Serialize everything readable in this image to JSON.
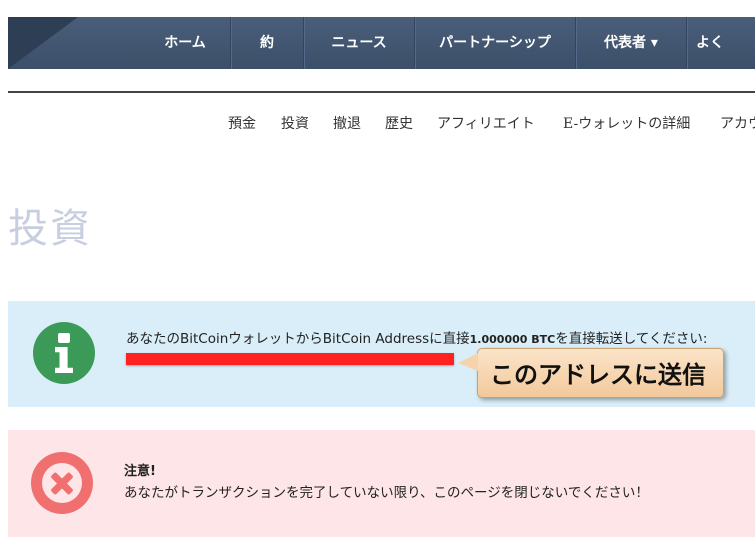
{
  "topnav": {
    "items": [
      {
        "label": "ホーム"
      },
      {
        "label": "約"
      },
      {
        "label": "ニュース"
      },
      {
        "label": "パートナーシップ"
      },
      {
        "label": "代表者 ▾"
      },
      {
        "label": "よく"
      }
    ]
  },
  "subnav": {
    "items": [
      {
        "label": "預金"
      },
      {
        "label": "投資"
      },
      {
        "label": "撤退"
      },
      {
        "label": "歴史"
      },
      {
        "label": "アフィリエイト"
      },
      {
        "label": "E-ウォレットの詳細"
      },
      {
        "label": "アカウ"
      }
    ]
  },
  "page_title": "投資",
  "info": {
    "icon": "info-icon",
    "text_before": "あなたのBitCoinウォレットからBitCoin Addressに直接",
    "amount": "1.000000 BTC",
    "text_after": "を直接転送してください:",
    "callout": "このアドレスに送信",
    "highlight_color": "#ff2222"
  },
  "warning": {
    "icon": "close-circle-icon",
    "title": "注意!",
    "text": "あなたがトランザクションを完了していない限り、このページを閉じないでください！"
  }
}
